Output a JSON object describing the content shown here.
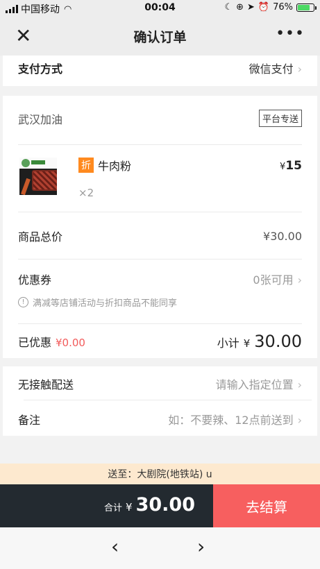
{
  "status_bar": {
    "carrier": "中国移动",
    "time": "00:04",
    "battery": "76%",
    "battery_level": 0.76
  },
  "header": {
    "title": "确认订单",
    "close_icon": "close-icon",
    "more_icon": "more-icon",
    "close_glyph": "✕",
    "more_glyph": "•••"
  },
  "payment": {
    "label": "支付方式",
    "value": "微信支付"
  },
  "order": {
    "store_name": "武汉加油",
    "delivery_badge": "平台专送",
    "product": {
      "discount_tag": "折",
      "name": "牛肉粉",
      "price_currency": "¥",
      "price": "15",
      "quantity": "×2"
    },
    "total_label": "商品总价",
    "total_value": "¥30.00",
    "coupon_label": "优惠券",
    "coupon_value": "0张可用",
    "notice": "满减等店铺活动与折扣商品不能同享",
    "discounted_label": "已优惠",
    "discounted_value": "¥0.00",
    "subtotal_label": "小计",
    "subtotal_currency": "¥",
    "subtotal_value": "30.00"
  },
  "extras": {
    "contactless_label": "无接触配送",
    "contactless_placeholder": "请输入指定位置",
    "remark_label": "备注",
    "remark_placeholder": "如：不要辣、12点前送到"
  },
  "address_bar": {
    "text": "送至：大剧院(地铁站) u"
  },
  "checkout": {
    "total_label": "合计",
    "total_currency": "¥",
    "total_value": "30.00",
    "button_label": "去结算"
  },
  "browser_nav": {
    "back_glyph": "‹",
    "forward_glyph": "›"
  },
  "colors": {
    "accent_red": "#f75f5f",
    "discount_orange": "#ff8a1f",
    "dark_bar": "#232a30",
    "address_bg": "#fde9cf"
  }
}
